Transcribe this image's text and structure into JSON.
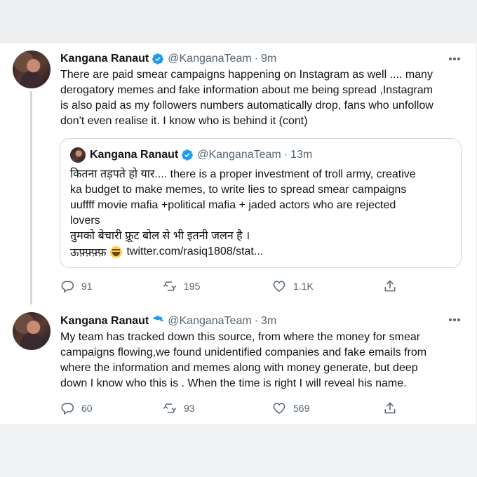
{
  "tweets": [
    {
      "author_name": "Kangana Ranaut",
      "handle": "@KanganaTeam",
      "separator": "·",
      "time": "9m",
      "text": "There are paid smear campaigns happening on Instagram as well .... many\nderogatory memes and fake information about me being spread ,Instagram\nis also paid as my followers numbers automatically drop, fans who unfollow\ndon't even realise it. I know who is behind it (cont)",
      "quote": {
        "author_name": "Kangana Ranaut",
        "handle": "@KanganaTeam",
        "separator": "·",
        "time": "13m",
        "text": "कितना तड़पते हो यार.... there is a proper investment of troll army, creative\nka budget to make memes, to write lies to spread smear campaigns\nuuffff movie mafia +political mafia + jaded actors who are rejected\nlovers\nतुमको बेचारी फ़्रूट बोल से भी इतनी जलन है ।",
        "last_line_prefix": "ऊफ़्फ़्फ़्फ़",
        "link": "twitter.com/rasiq1808/stat..."
      },
      "replies": "91",
      "retweets": "195",
      "likes": "1.1K"
    },
    {
      "author_name": "Kangana Ranaut",
      "handle": "@KanganaTeam",
      "separator": "·",
      "time": "3m",
      "text": "My team has tracked down this source, from where the money for smear\ncampaigns flowing,we found unidentified companies and fake emails from\nwhere the information and memes along with money generate, but deep\ndown I know who this is . When the time is right I will reveal his name.",
      "replies": "60",
      "retweets": "93",
      "likes": "569"
    }
  ],
  "colors": {
    "verified": "#1d9bf0",
    "secondary_text": "#536471",
    "border": "#cfd9de"
  },
  "icons": [
    "verified-badge-icon",
    "more-icon",
    "reply-icon",
    "retweet-icon",
    "like-icon",
    "share-icon",
    "grinning-emoji-icon"
  ]
}
